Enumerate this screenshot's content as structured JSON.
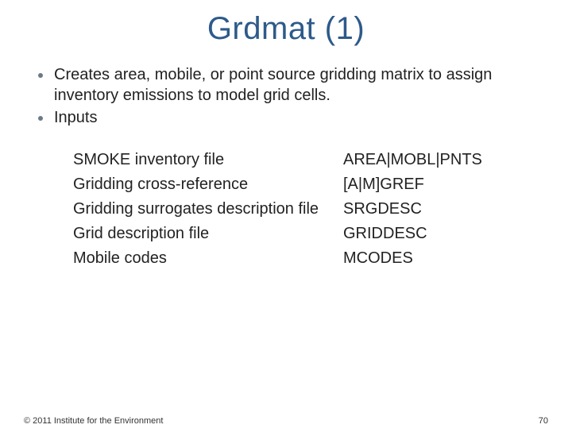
{
  "title": {
    "main": "Grdmat",
    "part": "(1)"
  },
  "bullets": [
    "Creates area, mobile, or point source gridding matrix to assign inventory emissions to model grid cells.",
    "Inputs"
  ],
  "table": [
    {
      "left": "SMOKE inventory file",
      "right": "AREA|MOBL|PNTS"
    },
    {
      "left": "Gridding cross-reference",
      "right": "[A|M]GREF"
    },
    {
      "left": "Gridding surrogates description file",
      "right": "SRGDESC"
    },
    {
      "left": "Grid description file",
      "right": "GRIDDESC"
    },
    {
      "left": "Mobile codes",
      "right": "MCODES"
    }
  ],
  "footer": "© 2011 Institute for the Environment",
  "page_number": "70"
}
